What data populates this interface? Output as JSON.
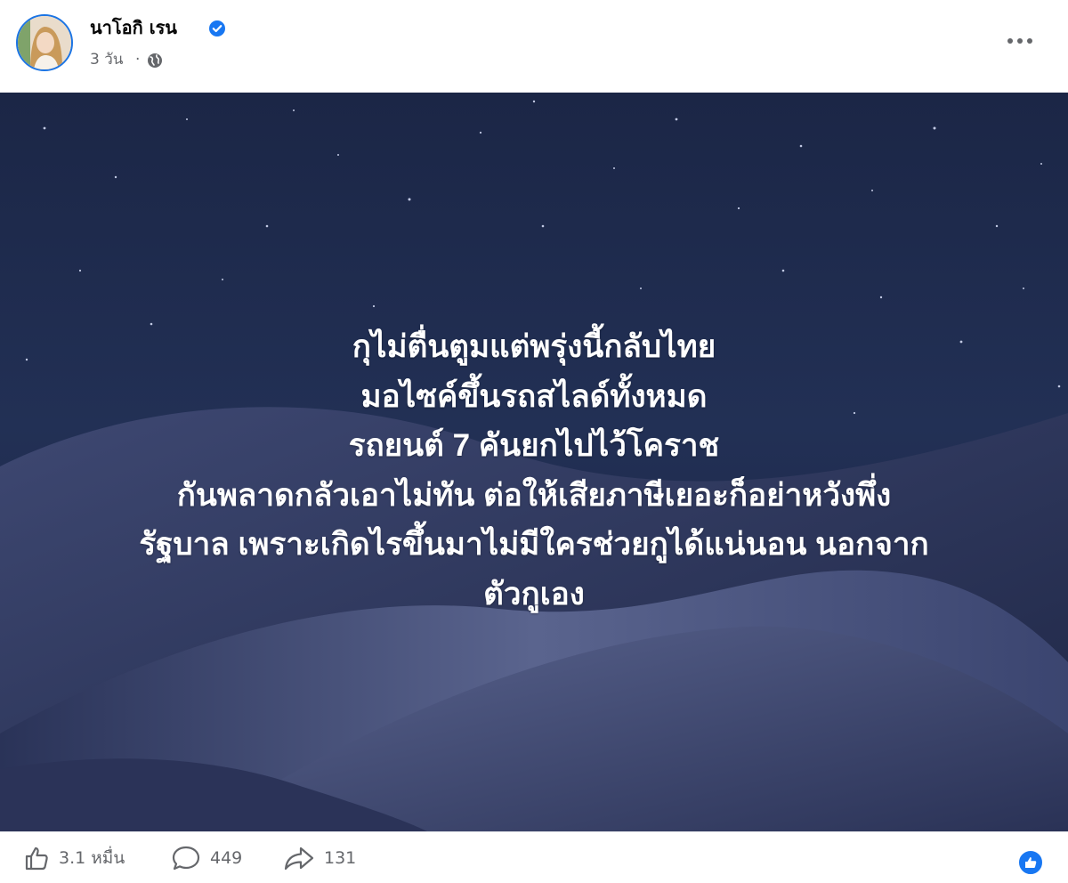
{
  "post": {
    "author": "นาโอกิ เรน",
    "time": "3 วัน",
    "separator": "·",
    "verified_icon": "verified-badge-icon",
    "privacy_icon": "globe-icon",
    "more_icon": "more-options-icon"
  },
  "image_text": {
    "lines": [
      "กุไม่ตื่นตูมแต่พรุ่งนี้กลับไทย",
      "มอไซค์ขึ้นรถสไลด์ทั้งหมด",
      "รถยนต์ 7 คันยกไปไว้โคราช",
      "กันพลาดกลัวเอาไม่ทัน ต่อให้เสียภาษีเยอะก็อย่าหวังพึ่ง",
      "รัฐบาล เพราะเกิดไรขึ้นมาไม่มีใครช่วยกูได้แน่นอน นอกจาก",
      "ตัวกูเอง"
    ]
  },
  "footer": {
    "likes": "3.1 หมื่น",
    "comments": "449",
    "shares": "131",
    "like_icon": "thumbs-up-icon",
    "comment_icon": "comment-bubble-icon",
    "share_icon": "share-arrow-icon",
    "reaction_icon": "like-reaction-icon"
  },
  "colors": {
    "accent": "#1877f2",
    "secondary_text": "#65676b",
    "sky": "#1d2a4a"
  }
}
